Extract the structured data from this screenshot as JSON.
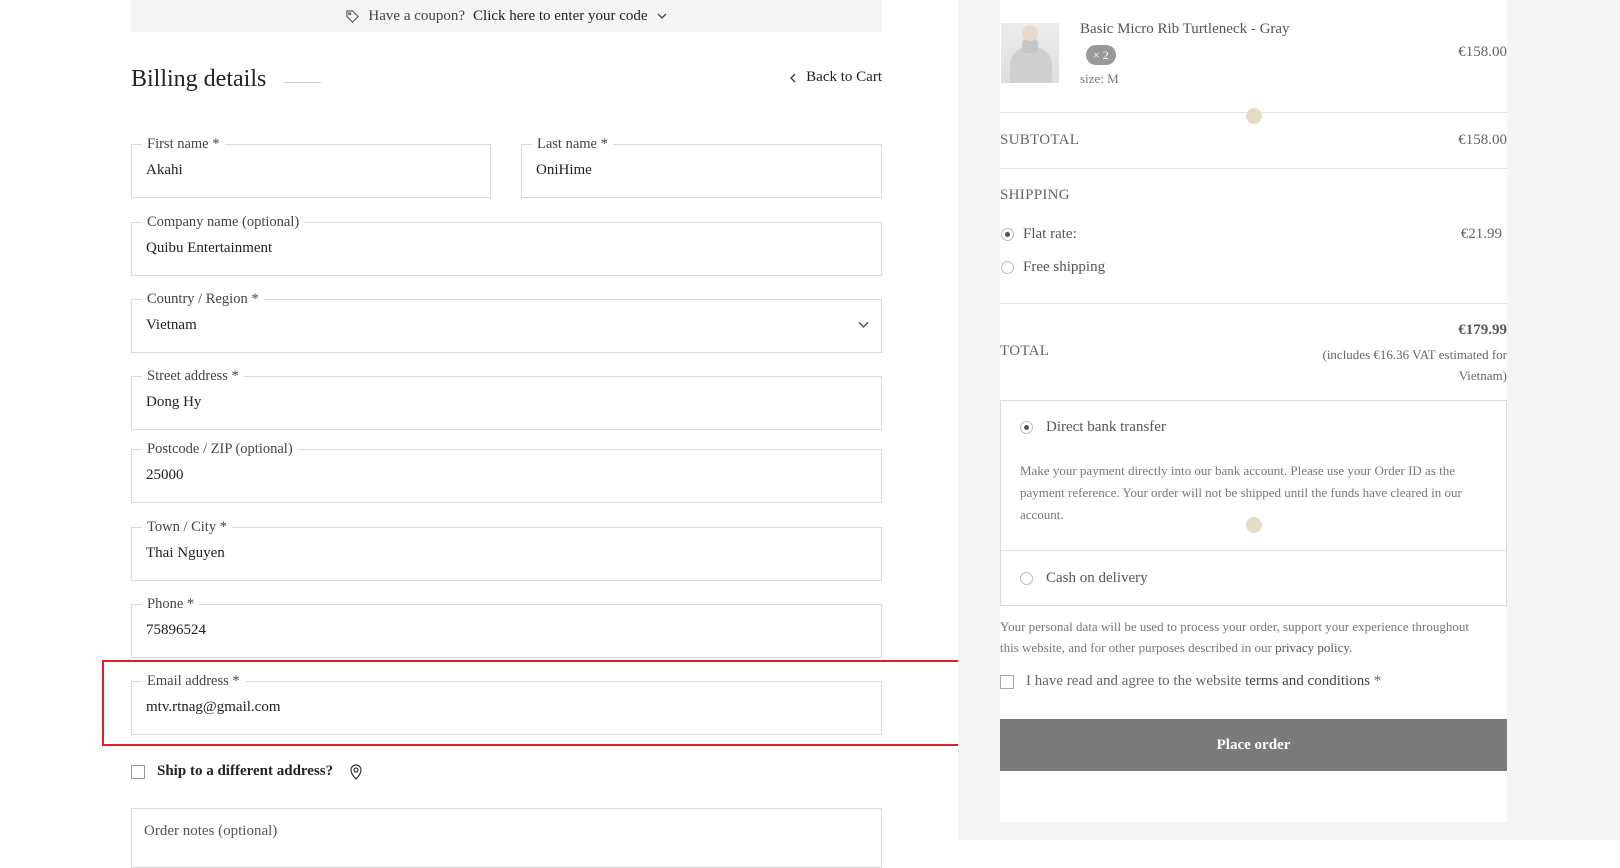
{
  "coupon": {
    "text": "Have a coupon?",
    "link": "Click here to enter your code"
  },
  "billing": {
    "title": "Billing details",
    "back_label": "Back to Cart",
    "fields": {
      "first_name": {
        "label": "First name *",
        "value": "Akahi"
      },
      "last_name": {
        "label": "Last name *",
        "value": "OniHime"
      },
      "company": {
        "label": "Company name (optional)",
        "value": "Quibu Entertainment"
      },
      "country": {
        "label": "Country / Region *",
        "value": "Vietnam"
      },
      "street": {
        "label": "Street address *",
        "value": "Dong Hy"
      },
      "postcode": {
        "label": "Postcode / ZIP (optional)",
        "value": "25000"
      },
      "city": {
        "label": "Town / City *",
        "value": "Thai Nguyen"
      },
      "phone": {
        "label": "Phone *",
        "value": "75896524"
      },
      "email": {
        "label": "Email address *",
        "value": "mtv.rtnag@gmail.com"
      }
    },
    "ship_different": "Ship to a different address?",
    "order_notes_label": "Order notes (optional)"
  },
  "summary": {
    "product": {
      "name": "Basic Micro Rib Turtleneck - Gray",
      "qty": "× 2",
      "size": "size: M",
      "price": "€158.00"
    },
    "subtotal_label": "SUBTOTAL",
    "subtotal_value": "€158.00",
    "shipping_label": "SHIPPING",
    "shipping_options": [
      {
        "label": "Flat rate:",
        "price": "€21.99",
        "selected": true
      },
      {
        "label": "Free shipping",
        "selected": false
      }
    ],
    "total_label": "TOTAL",
    "total_value": "€179.99",
    "total_note": "(includes €16.36 VAT estimated for Vietnam)",
    "payment": {
      "bank_label": "Direct bank transfer",
      "bank_desc": "Make your payment directly into our bank account. Please use your Order ID as the payment reference. Your order will not be shipped until the funds have cleared in our account.",
      "cod_label": "Cash on delivery"
    },
    "privacy_text": "Your personal data will be used to process your order, support your experience throughout this website, and for other purposes described in our",
    "privacy_link": "privacy policy.",
    "terms_text": "I have read and agree to the website",
    "terms_link": "terms and conditions",
    "terms_required": "*",
    "place_order": "Place order"
  },
  "colors": {
    "highlight": "#e01f26",
    "button": "#7a7a7a",
    "sidebar_bg": "#f5f5f5"
  }
}
